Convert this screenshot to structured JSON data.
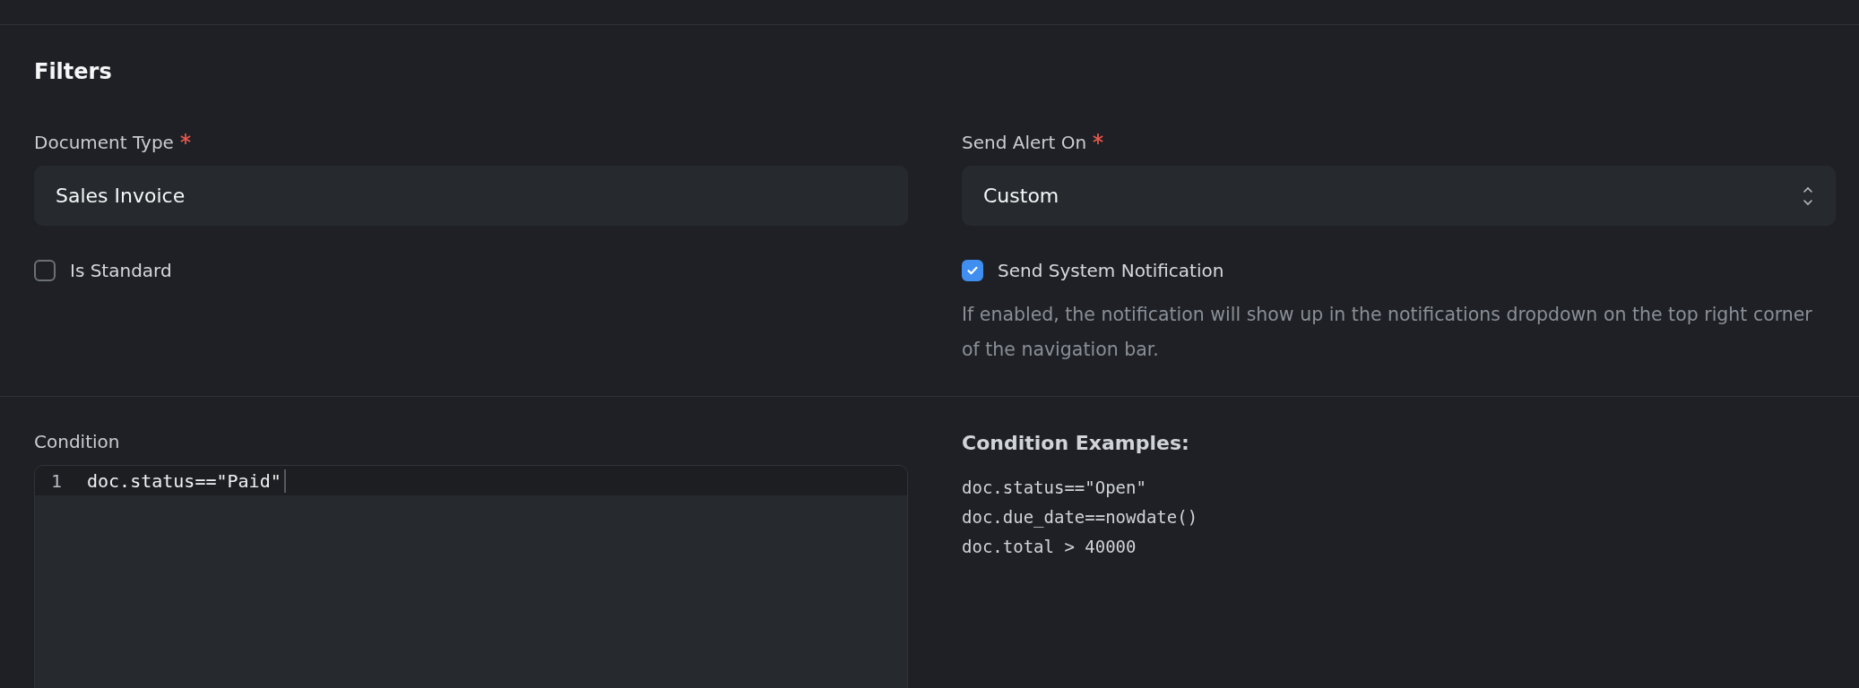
{
  "section": {
    "title": "Filters"
  },
  "document_type": {
    "label": "Document Type",
    "required": true,
    "value": "Sales Invoice"
  },
  "send_alert_on": {
    "label": "Send Alert On",
    "required": true,
    "value": "Custom"
  },
  "is_standard": {
    "label": "Is Standard",
    "checked": false
  },
  "send_system_notification": {
    "label": "Send System Notification",
    "checked": true,
    "description": "If enabled, the notification will show up in the notifications dropdown on the top right corner of the navigation bar."
  },
  "condition": {
    "label": "Condition",
    "lines": [
      {
        "number": "1",
        "code": "doc.status==\"Paid\"",
        "selected": true
      }
    ]
  },
  "condition_examples": {
    "title": "Condition Examples:",
    "lines": [
      "doc.status==\"Open\"",
      "doc.due_date==nowdate()",
      "doc.total > 40000"
    ]
  }
}
